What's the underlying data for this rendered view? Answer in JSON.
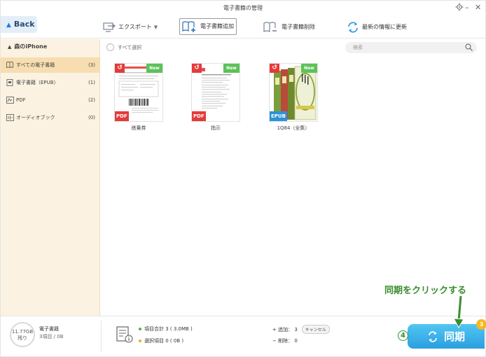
{
  "window": {
    "title": "電子書籍の管理"
  },
  "toolbar": {
    "back_label": "Back",
    "export_label": "エクスポート",
    "add_label": "電子書籍追加",
    "delete_label": "電子書籍削除",
    "refresh_label": "最新の情報に更新"
  },
  "sidebar": {
    "device_name": "森のiPhone",
    "items": [
      {
        "label": "すべての電子書籍",
        "count": "(3)"
      },
      {
        "label": "電子書籍（EPUB）",
        "count": "(1)"
      },
      {
        "label": "PDF",
        "count": "(2)"
      },
      {
        "label": "オーディオブック",
        "count": "(0)"
      }
    ]
  },
  "main": {
    "select_all_label": "すべて選択",
    "search_placeholder": "検索",
    "books": [
      {
        "title": "搭乗券",
        "type": "PDF",
        "badge": "New"
      },
      {
        "title": "指示",
        "type": "PDF",
        "badge": "New"
      },
      {
        "title": "1Q84（全集）",
        "type": "EPUB",
        "badge": "New"
      }
    ]
  },
  "footer": {
    "storage_value": "11.77GB",
    "storage_remaining": "残り",
    "storage_label": "電子書籍",
    "storage_sub": "3項目 / 0B",
    "total_items": "項目合計 3 ( 3.0MB )",
    "selected_items": "選択項目 0 ( 0B )",
    "add_label": "+ 追加： 3",
    "cancel_label": "キャンセル",
    "delete_label": "− 削除： 0",
    "sync_label": "同期",
    "sync_badge": "3",
    "step_number": "4"
  },
  "annotation": {
    "text": "同期をクリックする"
  },
  "colors": {
    "sidebar_bg": "#fbf2e1",
    "sidebar_active": "#f7ddb0",
    "accent_blue": "#2b9fe0",
    "new_badge": "#5cc25a",
    "pdf_badge": "#e53a3a",
    "annotation_green": "#3a8d2e"
  }
}
